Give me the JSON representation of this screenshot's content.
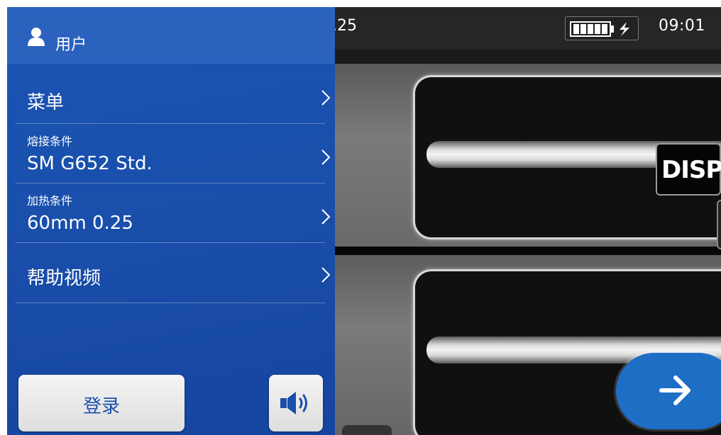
{
  "topbar": {
    "heater_value": ".25",
    "clock": "09:01"
  },
  "display_button": {
    "label": "DISP"
  },
  "menu": {
    "header": {
      "user_label": "用户",
      "icon": "user-icon"
    },
    "items": [
      {
        "title": "菜单",
        "value": ""
      },
      {
        "title": "熔接条件",
        "value": "SM G652 Std."
      },
      {
        "title": "加热条件",
        "value": "60mm 0.25"
      },
      {
        "title": "帮助视频",
        "value": ""
      }
    ],
    "login_label": "登录",
    "sound_icon": "speaker-icon"
  },
  "next_icon": "arrow-right-icon",
  "colors": {
    "menu_blue": "#1a4fab",
    "menu_header": "#2a62be",
    "next_button": "#1f6ec6",
    "login_text": "#1a4fab"
  }
}
